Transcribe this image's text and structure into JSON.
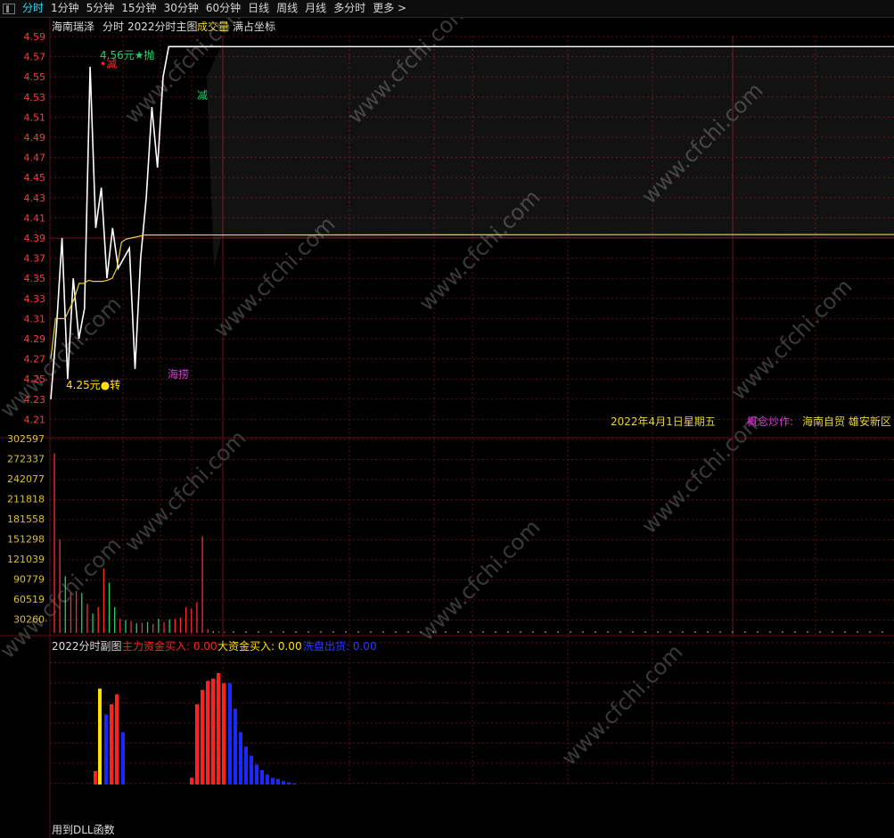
{
  "tabs": [
    {
      "label": "分时",
      "active": true
    },
    {
      "label": "1分钟"
    },
    {
      "label": "5分钟"
    },
    {
      "label": "15分钟"
    },
    {
      "label": "30分钟"
    },
    {
      "label": "60分钟"
    },
    {
      "label": "日线"
    },
    {
      "label": "周线"
    },
    {
      "label": "月线"
    },
    {
      "label": "多分时"
    },
    {
      "label": "更多 >"
    }
  ],
  "colors": {
    "background": "#000000",
    "grid": "#5c0f14",
    "up": "#ff2a2a",
    "down": "#22d06a",
    "price_line": "#ffffff",
    "avg_line": "#e6d23c",
    "tick_label": "#ff3b3b",
    "vol_label": "#d8c035",
    "main_fund": "#ff2020",
    "big_fund": "#ffe100",
    "wash": "#1a28ff",
    "concept": "#d640d6",
    "white_label": "#ffffff"
  },
  "header": {
    "stock": "海南瑞泽",
    "mode": "分时",
    "indicator": "2022分时主图",
    "volume_label": "成交量",
    "axis_mode": "满占坐标"
  },
  "date_text": "2022年4月1日星期五",
  "concept": {
    "label": "概念炒作:",
    "value": "海南自贸 雄安新区 !"
  },
  "sub_panel": {
    "title": "2022分时副图",
    "items": [
      {
        "label": "主力资金买入: 0.00",
        "color_key": "main_fund"
      },
      {
        "label": "大资金买入: 0.00",
        "color_key": "big_fund"
      },
      {
        "label": "洗盘出货: 0.00",
        "color_key": "wash"
      }
    ]
  },
  "footer_text": "用到DLL函数",
  "watermark": "www.cfchi.com",
  "chart_data": {
    "type": "line",
    "price_axis": {
      "ticks": [
        "4.59",
        "4.57",
        "4.55",
        "4.53",
        "4.51",
        "4.49",
        "4.47",
        "4.45",
        "4.43",
        "4.41",
        "4.39",
        "4.37",
        "4.35",
        "4.33",
        "4.31",
        "4.29",
        "4.27",
        "4.25",
        "4.23",
        "4.21"
      ],
      "range": [
        4.21,
        4.59
      ],
      "prev_close": 4.39
    },
    "series": [
      {
        "name": "price",
        "values": [
          4.23,
          4.3,
          4.39,
          4.25,
          4.35,
          4.29,
          4.32,
          4.56,
          4.4,
          4.44,
          4.35,
          4.4,
          4.36,
          4.37,
          4.38,
          4.26,
          4.37,
          4.43,
          4.52,
          4.46,
          4.55,
          4.58,
          4.58,
          4.58,
          4.58,
          4.58
        ]
      },
      {
        "name": "average",
        "values": [
          4.27,
          4.31,
          4.31,
          4.31,
          4.32,
          4.33,
          4.345,
          4.345,
          4.348,
          4.347,
          4.347,
          4.347,
          4.348,
          4.35,
          4.36,
          4.386,
          4.389,
          4.39,
          4.391,
          4.392,
          4.393,
          4.393,
          4.393
        ]
      }
    ],
    "annotations": [
      {
        "text": "4.56元★抛",
        "color": "down"
      },
      {
        "text": "•减",
        "color": "up"
      },
      {
        "text": "减",
        "color": "down"
      },
      {
        "text": "海捞",
        "color": "concept"
      },
      {
        "text": "4.25元●转",
        "color": "big_fund"
      }
    ],
    "volume_axis": {
      "ticks": [
        "302597",
        "272337",
        "242077",
        "211818",
        "181558",
        "151298",
        "121039",
        "90779",
        "60519",
        "30260"
      ],
      "max": 302597
    },
    "volume": [
      {
        "v": 278000,
        "c": "up"
      },
      {
        "v": 145000,
        "c": "up"
      },
      {
        "v": 88000,
        "c": "down"
      },
      {
        "v": 62000,
        "c": "up"
      },
      {
        "v": 65000,
        "c": "up"
      },
      {
        "v": 62000,
        "c": "down"
      },
      {
        "v": 45000,
        "c": "up"
      },
      {
        "v": 30000,
        "c": "down"
      },
      {
        "v": 40000,
        "c": "up"
      },
      {
        "v": 100000,
        "c": "up"
      },
      {
        "v": 78000,
        "c": "down"
      },
      {
        "v": 40000,
        "c": "down"
      },
      {
        "v": 22000,
        "c": "up"
      },
      {
        "v": 20000,
        "c": "down"
      },
      {
        "v": 18000,
        "c": "up"
      },
      {
        "v": 15000,
        "c": "down"
      },
      {
        "v": 16000,
        "c": "up"
      },
      {
        "v": 17000,
        "c": "down"
      },
      {
        "v": 14000,
        "c": "up"
      },
      {
        "v": 22000,
        "c": "down"
      },
      {
        "v": 17000,
        "c": "up"
      },
      {
        "v": 21000,
        "c": "down"
      },
      {
        "v": 22000,
        "c": "up"
      },
      {
        "v": 24000,
        "c": "up"
      },
      {
        "v": 40000,
        "c": "up"
      },
      {
        "v": 38000,
        "c": "up"
      },
      {
        "v": 48000,
        "c": "up"
      },
      {
        "v": 150000,
        "c": "up"
      },
      {
        "v": 6000,
        "c": "up"
      },
      {
        "v": 3000,
        "c": "down"
      },
      {
        "v": 2500,
        "c": "up"
      },
      {
        "v": 2000,
        "c": "up"
      }
    ],
    "fund_bars": [
      {
        "c": "up",
        "v": 0.12
      },
      {
        "c": "big",
        "v": 0.86
      },
      {
        "c": "wash",
        "v": 0.63
      },
      {
        "c": "up",
        "v": 0.72
      },
      {
        "c": "up",
        "v": 0.81
      },
      {
        "c": "wash",
        "v": 0.47
      },
      {
        "c": "up",
        "v": 0.06
      },
      {
        "c": "up",
        "v": 0.72
      },
      {
        "c": "up",
        "v": 0.85
      },
      {
        "c": "up",
        "v": 0.93
      },
      {
        "c": "up",
        "v": 0.95
      },
      {
        "c": "up",
        "v": 1.0
      },
      {
        "c": "up",
        "v": 0.91
      },
      {
        "c": "wash",
        "v": 0.91
      },
      {
        "c": "wash",
        "v": 0.68
      },
      {
        "c": "wash",
        "v": 0.47
      },
      {
        "c": "wash",
        "v": 0.34
      },
      {
        "c": "wash",
        "v": 0.26
      },
      {
        "c": "wash",
        "v": 0.18
      },
      {
        "c": "wash",
        "v": 0.13
      },
      {
        "c": "wash",
        "v": 0.09
      },
      {
        "c": "wash",
        "v": 0.06
      },
      {
        "c": "wash",
        "v": 0.05
      },
      {
        "c": "wash",
        "v": 0.03
      },
      {
        "c": "wash",
        "v": 0.02
      },
      {
        "c": "wash",
        "v": 0.01
      }
    ]
  }
}
